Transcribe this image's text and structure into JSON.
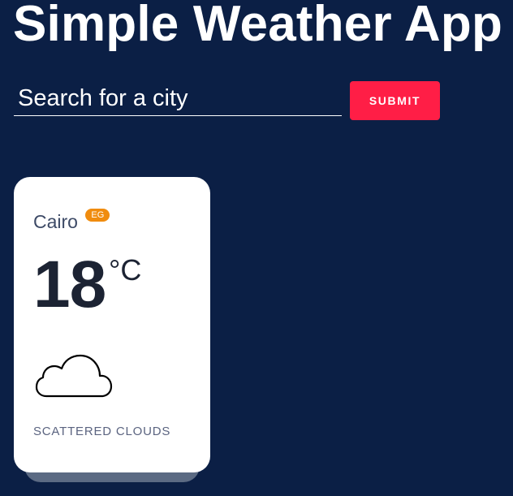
{
  "app": {
    "title": "Simple Weather App"
  },
  "search": {
    "placeholder": "Search for a city",
    "value": "",
    "submit_label": "SUBMIT"
  },
  "colors": {
    "background": "#0b1f45",
    "accent": "#ff1e46",
    "badge": "#f08c0f",
    "card": "#ffffff"
  },
  "weather_card": {
    "city": "Cairo",
    "country_code": "EG",
    "temperature": "18",
    "unit": "°C",
    "icon": "cloud-icon",
    "description": "SCATTERED CLOUDS"
  }
}
